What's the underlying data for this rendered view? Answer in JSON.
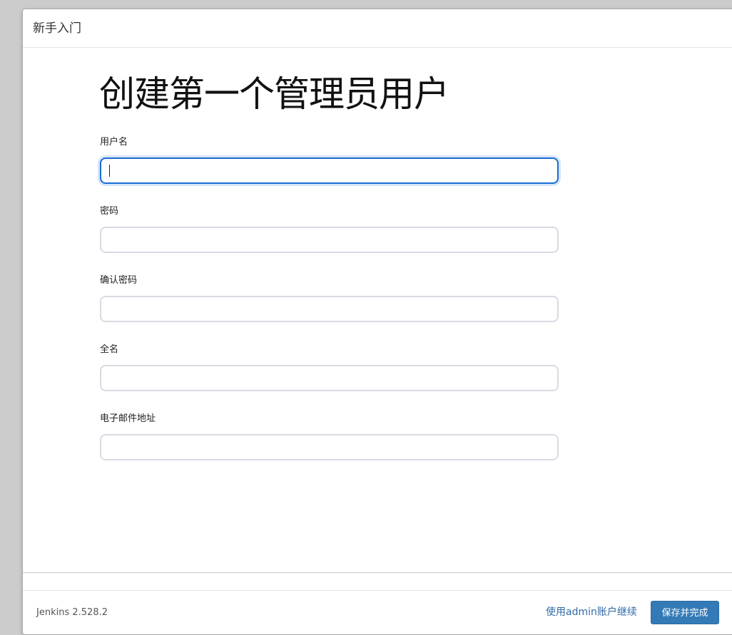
{
  "dialog": {
    "title": "新手入门"
  },
  "form": {
    "heading": "创建第一个管理员用户",
    "fields": [
      {
        "label": "用户名",
        "value": "",
        "placeholder": ""
      },
      {
        "label": "密码",
        "value": "",
        "placeholder": ""
      },
      {
        "label": "确认密码",
        "value": "",
        "placeholder": ""
      },
      {
        "label": "全名",
        "value": "",
        "placeholder": ""
      },
      {
        "label": "电子邮件地址",
        "value": "",
        "placeholder": ""
      }
    ]
  },
  "footer": {
    "version": "Jenkins 2.528.2",
    "continue_as_admin": "使用admin账户继续",
    "save_and_finish": "保存并完成"
  },
  "colors": {
    "primary_button": "#337ab7",
    "link": "#2f6aa6",
    "focus_border": "#1a6dd1"
  }
}
